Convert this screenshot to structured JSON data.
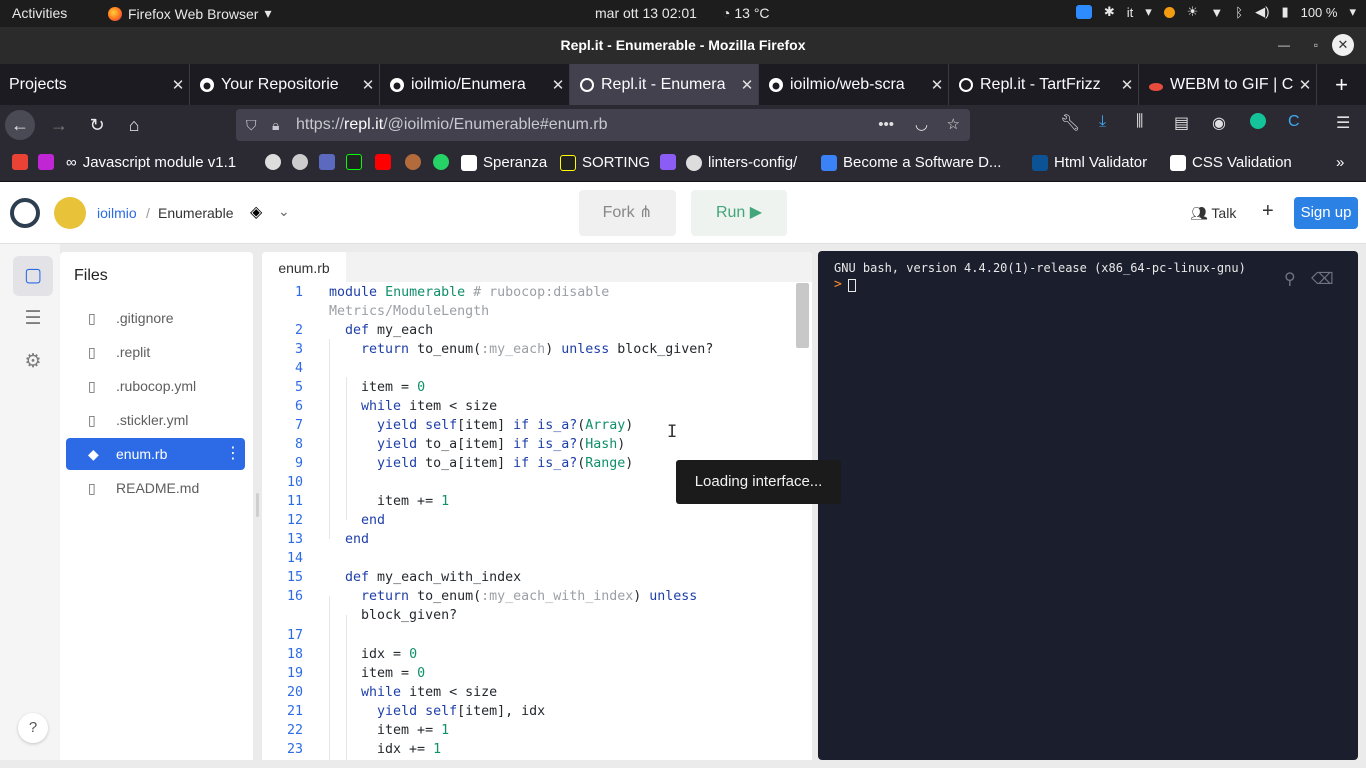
{
  "system_bar": {
    "activities": "Activities",
    "app_name": "Firefox Web Browser",
    "clock": "mar ott 13  02:01",
    "weather": "13 °C",
    "language": "it",
    "battery": "100 %"
  },
  "window": {
    "title": "Repl.it - Enumerable - Mozilla Firefox"
  },
  "tabs": [
    {
      "label": "Projects",
      "icon": "none"
    },
    {
      "label": "Your Repositorie",
      "icon": "github-icon"
    },
    {
      "label": "ioilmio/Enumera",
      "icon": "github-icon"
    },
    {
      "label": "Repl.it - Enumera",
      "icon": "replit-icon",
      "active": true
    },
    {
      "label": "ioilmio/web-scra",
      "icon": "github-icon"
    },
    {
      "label": "Repl.it - TartFrizz",
      "icon": "replit-icon"
    },
    {
      "label": "WEBM to GIF | Cl",
      "icon": "cloud-icon"
    }
  ],
  "address_bar": {
    "prefix": "https://",
    "host": "repl.it",
    "path": "/@ioilmio/Enumerable#enum.rb"
  },
  "bookmarks": [
    {
      "label": "Javascript module v1.1"
    },
    {
      "label": "Speranza"
    },
    {
      "label": "SORTING"
    },
    {
      "label": "linters-config/"
    },
    {
      "label": "Become a Software D..."
    },
    {
      "label": "Html Validator"
    },
    {
      "label": "CSS Validation"
    }
  ],
  "replit_header": {
    "username": "ioilmio",
    "separator": "/",
    "repl_name": "Enumerable",
    "fork_label": "Fork",
    "run_label": "Run ▶",
    "talk_label": "Talk",
    "new_label": "+",
    "signup_label": "Sign up"
  },
  "files_panel": {
    "title": "Files",
    "files": [
      {
        "name": ".gitignore"
      },
      {
        "name": ".replit"
      },
      {
        "name": ".rubocop.yml"
      },
      {
        "name": ".stickler.yml"
      },
      {
        "name": "enum.rb",
        "active": true
      },
      {
        "name": "README.md"
      }
    ]
  },
  "editor": {
    "tab_label": "enum.rb",
    "tooltip": "Loading interface...",
    "line_numbers": [
      "1",
      "",
      "2",
      "3",
      "4",
      "5",
      "6",
      "7",
      "8",
      "9",
      "10",
      "11",
      "12",
      "13",
      "14",
      "15",
      "16",
      "",
      "17",
      "18",
      "19",
      "20",
      "21",
      "22",
      "23"
    ]
  },
  "terminal": {
    "banner": "GNU bash, version 4.4.20(1)-release (x86_64-pc-linux-gnu)",
    "prompt": ">"
  },
  "help_label": "?",
  "colors": {
    "accent": "#2c6be5",
    "run_green": "#42a67a",
    "signup_blue": "#2c81e5",
    "terminal_bg": "#1b1e2c"
  }
}
